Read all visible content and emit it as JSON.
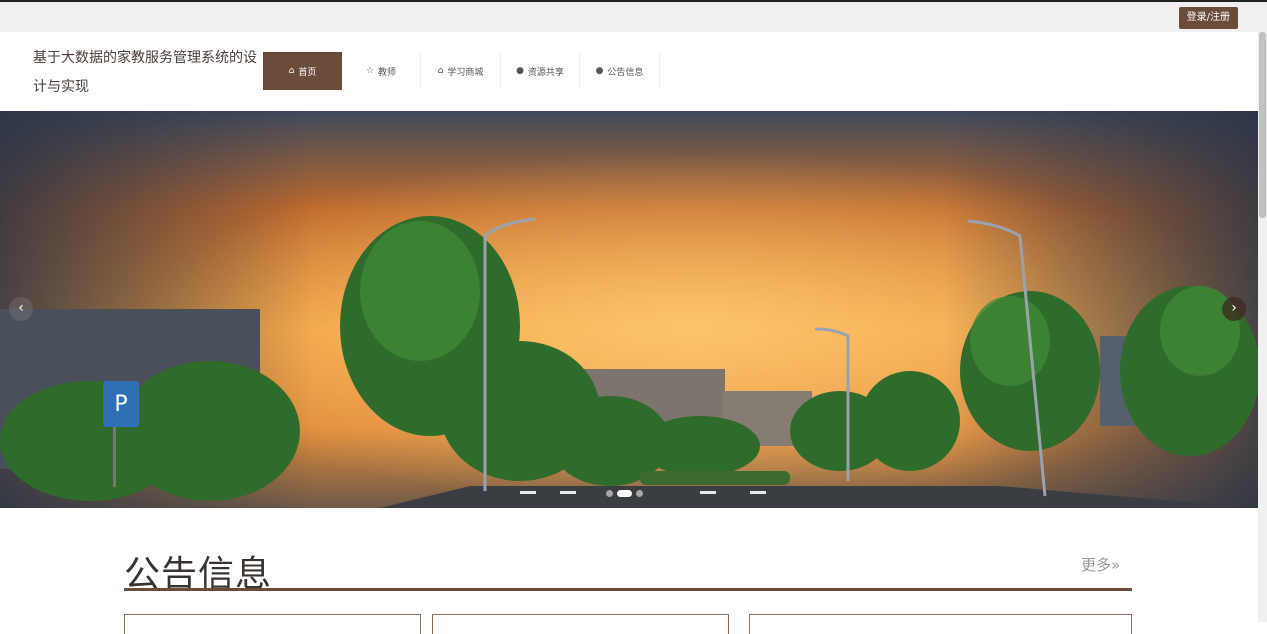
{
  "topbar": {
    "login_label": "登录/注册"
  },
  "header": {
    "site_title": "基于大数据的家教服务管理系统的设计与实现"
  },
  "nav": {
    "items": [
      {
        "label": "首页",
        "icon": "home-icon",
        "active": true
      },
      {
        "label": "教师",
        "icon": "star-icon",
        "active": false
      },
      {
        "label": "学习商城",
        "icon": "shop-icon",
        "active": false
      },
      {
        "label": "资源共享",
        "icon": "info-circle-icon",
        "active": false
      },
      {
        "label": "公告信息",
        "icon": "question-circle-icon",
        "active": false
      }
    ]
  },
  "banner": {
    "prev_label": "‹",
    "next_label": "›",
    "slide_count": 3,
    "active_slide": 2
  },
  "notice": {
    "title": "公告信息",
    "more_label": "更多»"
  },
  "colors": {
    "accent": "#6b4c3b",
    "topbar_bg": "#f1eff1"
  }
}
